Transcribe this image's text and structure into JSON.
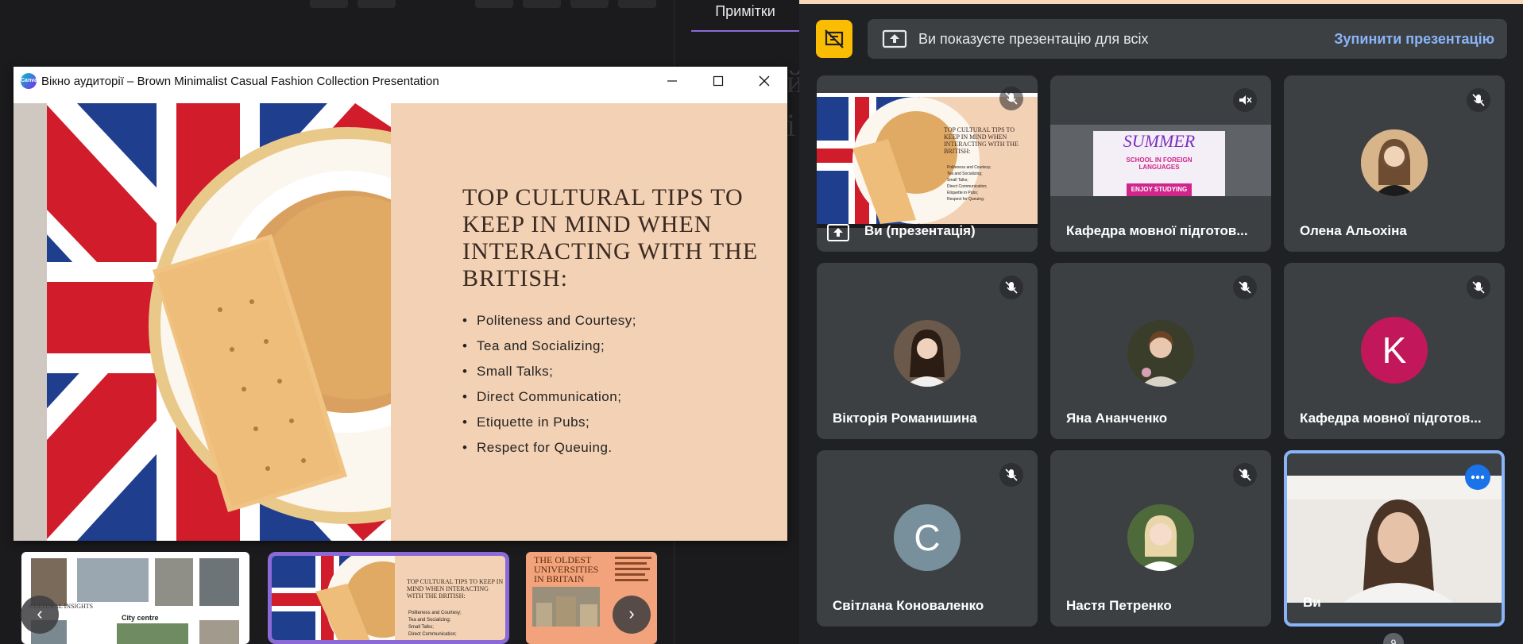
{
  "presenter": {
    "notes_tab": "Примітки",
    "faded_letters": [
      "й",
      "i"
    ]
  },
  "audience_window": {
    "app_logo_text": "Canva",
    "title": "Вікно аудиторії – Brown Minimalist Casual Fashion Collection Presentation",
    "controls": [
      "minimize-icon",
      "maximize-icon",
      "close-icon"
    ]
  },
  "slide": {
    "heading": "TOP CULTURAL TIPS TO KEEP IN MIND WHEN INTERACTING WITH THE BRITISH:",
    "bullets": [
      "Politeness and Courtesy;",
      "Tea and Socializing;",
      "Small Talks;",
      "Direct Communication;",
      "Etiquette in Pubs;",
      "Respect for Queuing."
    ]
  },
  "thumbnails": {
    "t1_title": "CULTURAL INSIGHTS",
    "t1_caption": "City centre",
    "t2_heading": "TOP CULTURAL TIPS TO KEEP IN MIND WHEN INTERACTING WITH THE BRITISH:",
    "t2_bullets": [
      "Politeness and Courtesy;",
      "Tea and Socializing;",
      "Small Talks;",
      "Direct Communication;"
    ],
    "t3_heading": "THE OLDEST UNIVERSITIES IN BRITAIN",
    "prev_arrow": "‹",
    "next_arrow": "›"
  },
  "meet": {
    "presenting_text": "Ви показуєте презентацію для всіх",
    "stop_presenting": "Зупинити презентацію",
    "tiles": [
      {
        "name": "Ви (презентація)",
        "kind": "presentation"
      },
      {
        "name": "Кафедра мовної підготов...",
        "kind": "screen",
        "screen_title": "SUMMER",
        "screen_sub": "SCHOOL IN FOREIGN LANGUAGES",
        "screen_btn": "ENJOY STUDYING"
      },
      {
        "name": "Олена Альохіна",
        "kind": "photo"
      },
      {
        "name": "Вікторія Романишина",
        "kind": "photo"
      },
      {
        "name": "Яна Ананченко",
        "kind": "photo"
      },
      {
        "name": "Кафедра мовної підготов...",
        "kind": "letter",
        "letter": "K",
        "color": "#c2185b"
      },
      {
        "name": "Світлана Коноваленко",
        "kind": "letter",
        "letter": "С",
        "color": "#78909c"
      },
      {
        "name": "Настя Петренко",
        "kind": "photo"
      },
      {
        "name": "Ви",
        "kind": "camera"
      }
    ],
    "participants_count": "9"
  },
  "colors": {
    "accent_purple": "#8b6ad8",
    "meet_blue": "#8ab4f8",
    "present_yellow": "#fbbc04",
    "tile_bg": "#3c4043",
    "slide_bg": "#f3d1b4"
  }
}
